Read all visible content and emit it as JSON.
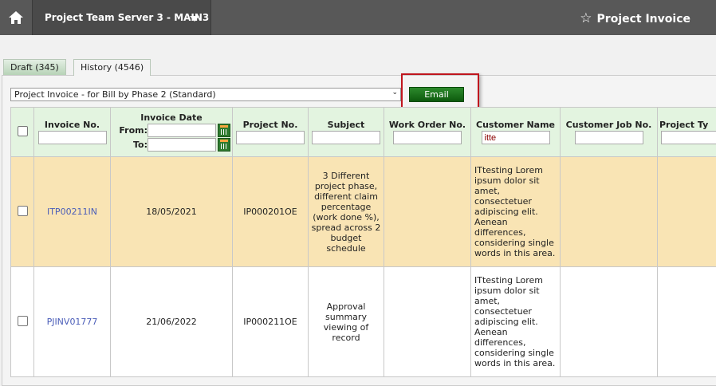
{
  "header": {
    "project_selector": "Project Team Server 3 - MAIN3",
    "page_title": "Project Invoice"
  },
  "tabs": [
    {
      "label": "Draft (345)"
    },
    {
      "label": "History (4546)"
    }
  ],
  "template_select": {
    "value": "Project Invoice - for Bill by Phase 2 (Standard)"
  },
  "email_button": "Email",
  "columns": {
    "invoice_no": "Invoice No.",
    "invoice_date": "Invoice Date",
    "from": "From:",
    "to": "To:",
    "project_no": "Project No.",
    "subject": "Subject",
    "work_order_no": "Work Order No.",
    "customer_name": "Customer Name",
    "customer_job_no": "Customer Job No.",
    "project_type": "Project Ty"
  },
  "filters": {
    "customer_name": "itte"
  },
  "rows": [
    {
      "invoice_no": "ITP00211IN",
      "date": "18/05/2021",
      "project_no": "IP000201OE",
      "subject": "3 Different project phase, different claim percentage (work done %), spread across 2 budget schedule",
      "work_order_no": "",
      "customer_name": "ITtesting Lorem ipsum dolor sit amet, consectetuer adipiscing elit. Aenean differences, considering single words in this area."
    },
    {
      "invoice_no": "PJINV01777",
      "date": "21/06/2022",
      "project_no": "IP000211OE",
      "subject": "Approval summary viewing of record",
      "work_order_no": "",
      "customer_name": "ITtesting Lorem ipsum dolor sit amet, consectetuer adipiscing elit. Aenean differences, considering single words in this area."
    }
  ]
}
